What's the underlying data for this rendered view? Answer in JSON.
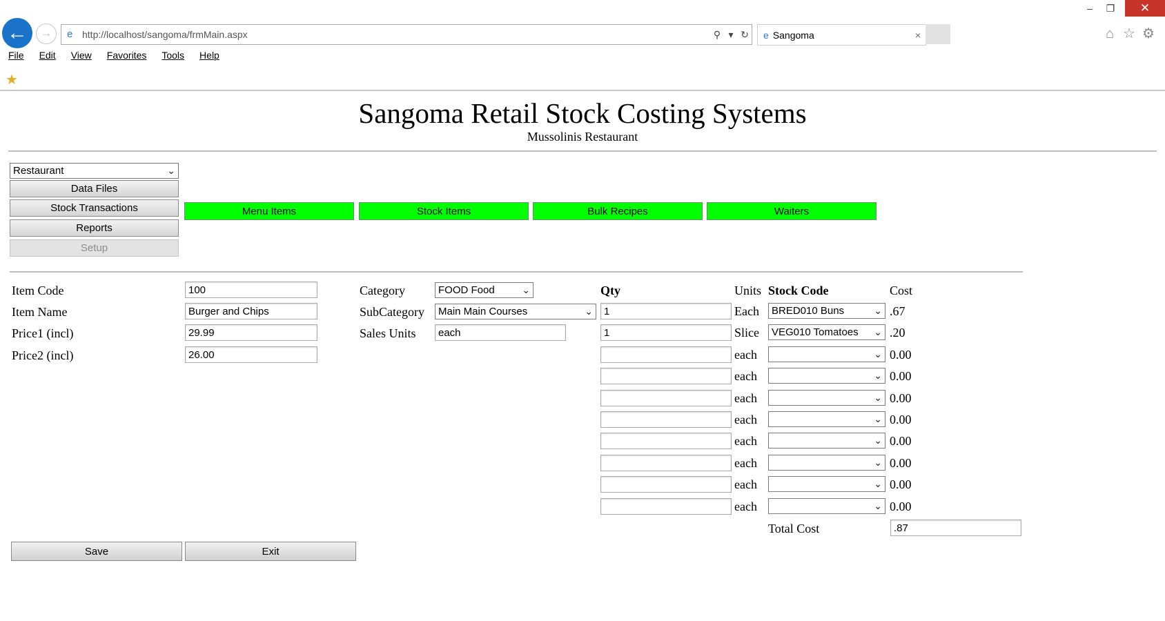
{
  "browser": {
    "url": "http://localhost/sangoma/frmMain.aspx",
    "tab_title": "Sangoma",
    "menu": [
      "File",
      "Edit",
      "View",
      "Favorites",
      "Tools",
      "Help"
    ],
    "window_buttons": {
      "minimize": "–",
      "restore": "❐",
      "close": "✕"
    }
  },
  "header": {
    "title": "Sangoma Retail Stock Costing Systems",
    "subtitle": "Mussolinis Restaurant"
  },
  "nav": {
    "mode_select": "Restaurant",
    "buttons": [
      "Data Files",
      "Stock Transactions",
      "Reports",
      "Setup"
    ],
    "green_buttons": [
      "Menu Items",
      "Stock Items",
      "Bulk Recipes",
      "Waiters"
    ],
    "green_color": "#00ff00"
  },
  "item": {
    "code_label": "Item Code",
    "code_value": "100",
    "name_label": "Item Name",
    "name_value": "Burger and Chips",
    "price1_label": "Price1 (incl)",
    "price1_value": "29.99",
    "price2_label": "Price2 (incl)",
    "price2_value": "26.00",
    "category_label": "Category",
    "category_value": "FOOD Food",
    "subcategory_label": "SubCategory",
    "subcategory_value": "Main Main Courses",
    "sales_units_label": "Sales Units",
    "sales_units_value": "each"
  },
  "recipe": {
    "headers": {
      "qty": "Qty",
      "units": "Units",
      "stock_code": "Stock Code",
      "cost": "Cost"
    },
    "rows": [
      {
        "qty": "1",
        "units": "Each",
        "stock_code": "BRED010 Buns",
        "cost": ".67"
      },
      {
        "qty": "1",
        "units": "Slice",
        "stock_code": "VEG010 Tomatoes",
        "cost": ".20"
      },
      {
        "qty": "",
        "units": "each",
        "stock_code": "",
        "cost": "0.00"
      },
      {
        "qty": "",
        "units": "each",
        "stock_code": "",
        "cost": "0.00"
      },
      {
        "qty": "",
        "units": "each",
        "stock_code": "",
        "cost": "0.00"
      },
      {
        "qty": "",
        "units": "each",
        "stock_code": "",
        "cost": "0.00"
      },
      {
        "qty": "",
        "units": "each",
        "stock_code": "",
        "cost": "0.00"
      },
      {
        "qty": "",
        "units": "each",
        "stock_code": "",
        "cost": "0.00"
      },
      {
        "qty": "",
        "units": "each",
        "stock_code": "",
        "cost": "0.00"
      },
      {
        "qty": "",
        "units": "each",
        "stock_code": "",
        "cost": "0.00"
      }
    ],
    "total_label": "Total Cost",
    "total_value": ".87"
  },
  "actions": {
    "save": "Save",
    "exit": "Exit"
  }
}
